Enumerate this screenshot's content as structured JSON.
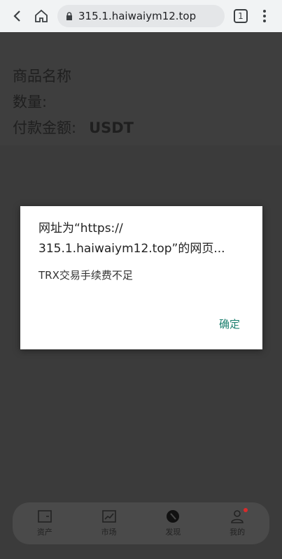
{
  "browser": {
    "url": "315.1.haiwaiym12.top",
    "tab_count": "1"
  },
  "product": {
    "name_label": "商品名称",
    "quantity_label": "数量:",
    "amount_label": "付款金额:",
    "amount_unit": "USDT"
  },
  "dialog": {
    "title_line1": "网址为“https://",
    "title_line2": "315.1.haiwaiym12.top”的网页...",
    "message": "TRX交易手续费不足",
    "ok_label": "确定"
  },
  "nav": {
    "items": [
      {
        "label": "资产",
        "icon": "wallet-icon"
      },
      {
        "label": "市场",
        "icon": "chart-icon"
      },
      {
        "label": "发现",
        "icon": "discover-icon"
      },
      {
        "label": "我的",
        "icon": "profile-icon"
      }
    ]
  },
  "colors": {
    "accent": "#1a7f6e",
    "badge": "#d92b2b"
  }
}
